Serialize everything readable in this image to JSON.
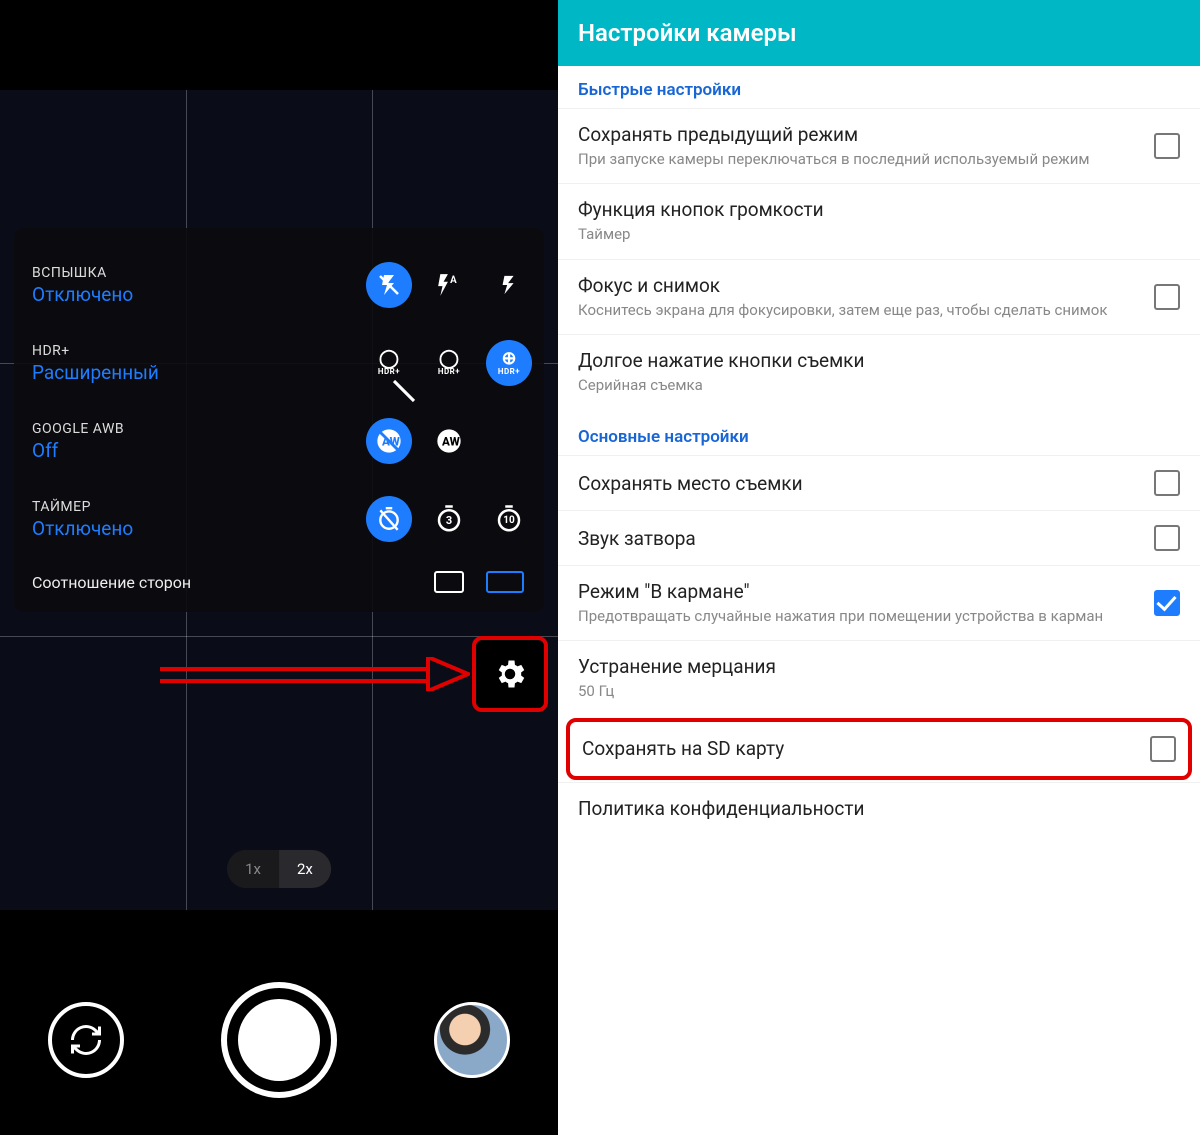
{
  "camera": {
    "flash": {
      "label": "ВСПЫШКА",
      "value": "Отключено"
    },
    "hdr": {
      "label": "HDR+",
      "value": "Расширенный"
    },
    "awb": {
      "label": "GOOGLE AWB",
      "value": "Off"
    },
    "timer": {
      "label": "ТАЙМЕР",
      "value": "Отключено",
      "opt3": "3",
      "opt10": "10"
    },
    "aspect": {
      "label": "Соотношение сторон"
    },
    "zoom": {
      "z1": "1x",
      "z2": "2x"
    }
  },
  "settings": {
    "title": "Настройки камеры",
    "section_quick": "Быстрые настройки",
    "section_main": "Основные настройки",
    "prev_mode": {
      "title": "Сохранять предыдущий режим",
      "desc": "При запуске камеры переключаться в последний используемый режим"
    },
    "vol_keys": {
      "title": "Функция кнопок громкости",
      "desc": "Таймер"
    },
    "focus_shot": {
      "title": "Фокус и снимок",
      "desc": "Коснитесь экрана для фокусировки, затем еще раз, чтобы сделать снимок"
    },
    "long_press": {
      "title": "Долгое нажатие кнопки съемки",
      "desc": "Серийная съемка"
    },
    "save_loc": {
      "title": "Сохранять место съемки"
    },
    "shutter_snd": {
      "title": "Звук затвора"
    },
    "pocket": {
      "title": "Режим \"В кармане\"",
      "desc": "Предотвращать случайные нажатия при помещении устройства в карман"
    },
    "flicker": {
      "title": "Устранение мерцания",
      "desc": "50 Гц"
    },
    "save_sd": {
      "title": "Сохранять на SD карту"
    },
    "privacy": {
      "title": "Политика конфиденциальности"
    }
  }
}
